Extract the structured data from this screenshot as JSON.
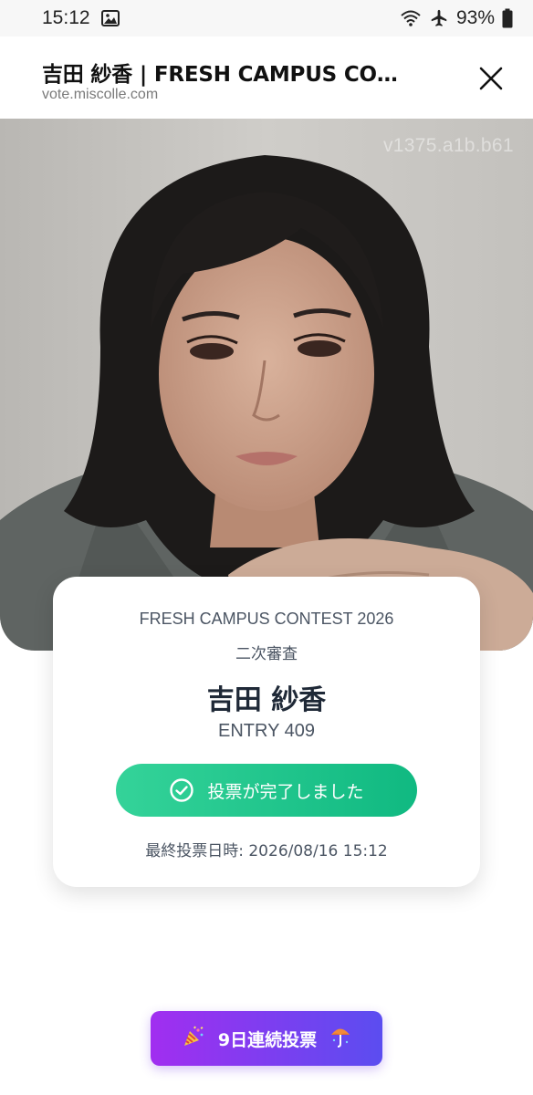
{
  "status_bar": {
    "time": "15:12",
    "battery": "93%",
    "icons": [
      "image-icon",
      "wifi-icon",
      "airplane-icon",
      "battery-icon"
    ]
  },
  "browser": {
    "title": "吉田 紗香 | FRESH CAMPUS CO…",
    "url": "vote.miscolle.com",
    "close_icon": "close-icon"
  },
  "photo": {
    "watermark": "v1375.a1b.b61"
  },
  "card": {
    "contest_name": "FRESH CAMPUS CONTEST 2026",
    "stage": "二次審査",
    "entrant_name": "吉田 紗香",
    "entry_number": "ENTRY 409",
    "vote_button_label": "投票が完了しました",
    "last_vote": "最終投票日時: 2026/08/16 15:12",
    "colors": {
      "button_start": "#34d399",
      "button_end": "#10b981"
    }
  },
  "streak_button": {
    "label": "9日連続投票",
    "left_icon": "party-icon",
    "right_icon": "umbrella-icon",
    "colors": {
      "start": "#a12ef0",
      "end": "#5b4df0"
    }
  }
}
